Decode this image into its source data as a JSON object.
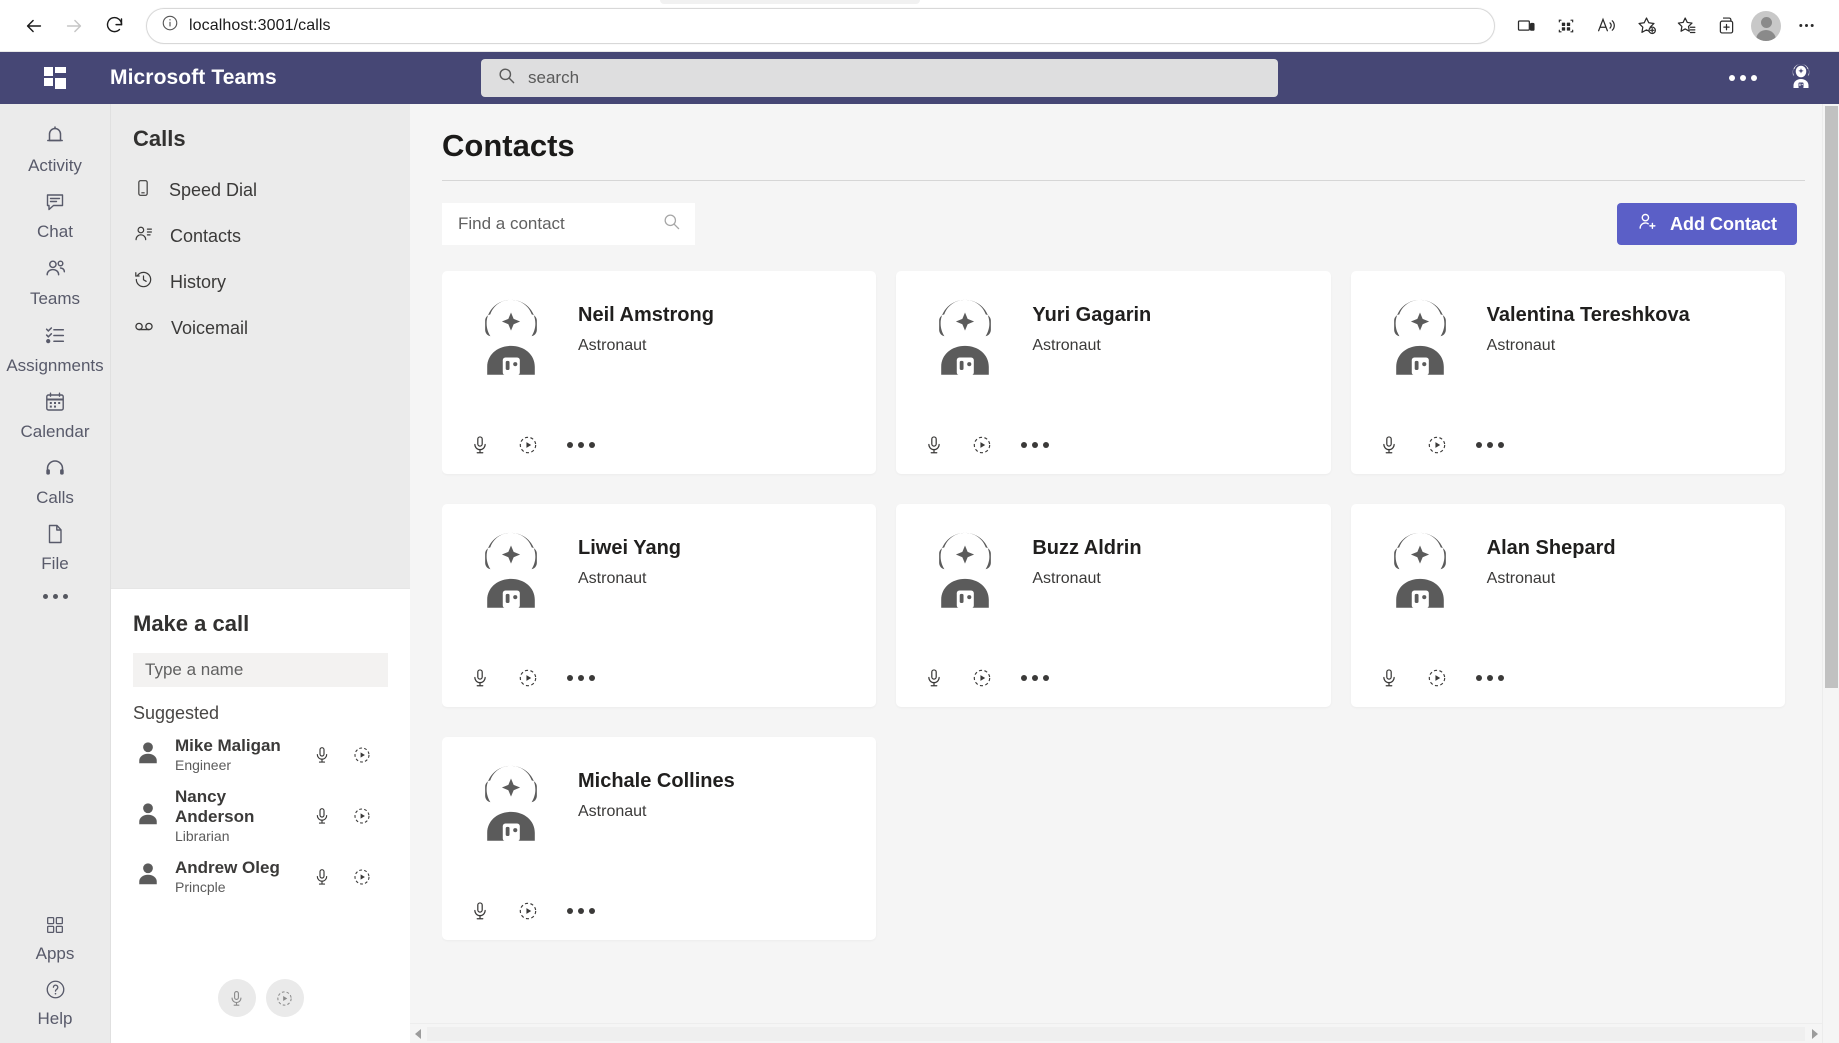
{
  "browser": {
    "back_label": "Back",
    "forward_label": "Forward",
    "reload_label": "Refresh",
    "url_prefix": "localhost",
    "url_suffix": ":3001/calls",
    "url_full": "localhost:3001/calls",
    "toolbar_icons": [
      "cast-icon",
      "collections-grid-icon",
      "read-aloud-icon",
      "add-favorite-icon",
      "favorites-icon",
      "split-screen-icon",
      "profile-avatar-icon",
      "settings-more-icon"
    ]
  },
  "teams_header": {
    "title": "Microsoft Teams",
    "waffle_label": "app-launcher",
    "search_placeholder": "search",
    "more_label": "More options",
    "avatar_label": "Account"
  },
  "rail": {
    "items": [
      {
        "label": "Activity",
        "icon": "bell-icon"
      },
      {
        "label": "Chat",
        "icon": "chat-bubble-icon"
      },
      {
        "label": "Teams",
        "icon": "people-icon"
      },
      {
        "label": "Assignments",
        "icon": "checklist-icon"
      },
      {
        "label": "Calendar",
        "icon": "calendar-icon"
      },
      {
        "label": "Calls",
        "icon": "headset-icon"
      },
      {
        "label": "File",
        "icon": "document-icon"
      }
    ],
    "more_label": "More apps",
    "bottom_items": [
      {
        "label": "Apps",
        "icon": "apps-grid-icon"
      },
      {
        "label": "Help",
        "icon": "help-circle-icon"
      }
    ]
  },
  "calls_panel": {
    "title": "Calls",
    "nav": [
      {
        "label": "Speed Dial",
        "icon": "phone-icon"
      },
      {
        "label": "Contacts",
        "icon": "contacts-icon"
      },
      {
        "label": "History",
        "icon": "history-icon"
      },
      {
        "label": "Voicemail",
        "icon": "voicemail-icon"
      }
    ],
    "make_a_call": {
      "title": "Make a call",
      "input_placeholder": "Type a name",
      "suggested_label": "Suggested",
      "suggested": [
        {
          "name": "Mike Maligan",
          "role": "Engineer"
        },
        {
          "name": "Nancy Anderson",
          "role": "Librarian"
        },
        {
          "name": "Andrew Oleg",
          "role": "Princple"
        }
      ],
      "action_icons": [
        "microphone-icon",
        "video-call-icon"
      ],
      "fab_icons": [
        "microphone-icon",
        "video-call-icon"
      ]
    }
  },
  "main": {
    "page_title": "Contacts",
    "search_placeholder": "Find a contact",
    "add_contact_label": "Add Contact",
    "contacts": [
      {
        "name": "Neil Amstrong",
        "role": "Astronaut"
      },
      {
        "name": "Yuri Gagarin",
        "role": "Astronaut"
      },
      {
        "name": "Valentina Tereshkova",
        "role": "Astronaut"
      },
      {
        "name": "Liwei Yang",
        "role": "Astronaut"
      },
      {
        "name": "Buzz Aldrin",
        "role": "Astronaut"
      },
      {
        "name": "Alan Shepard",
        "role": "Astronaut"
      },
      {
        "name": "Michale Collines",
        "role": "Astronaut"
      }
    ],
    "card_actions": [
      "microphone-icon",
      "video-call-icon",
      "more-options-icon"
    ]
  },
  "colors": {
    "teams_purple": "#464775",
    "accent_button": "#5b5fc7",
    "rail_bg": "#ebebeb",
    "main_bg": "#f5f5f5",
    "card_bg": "#ffffff",
    "avatar_gray": "#5b5b5b"
  }
}
